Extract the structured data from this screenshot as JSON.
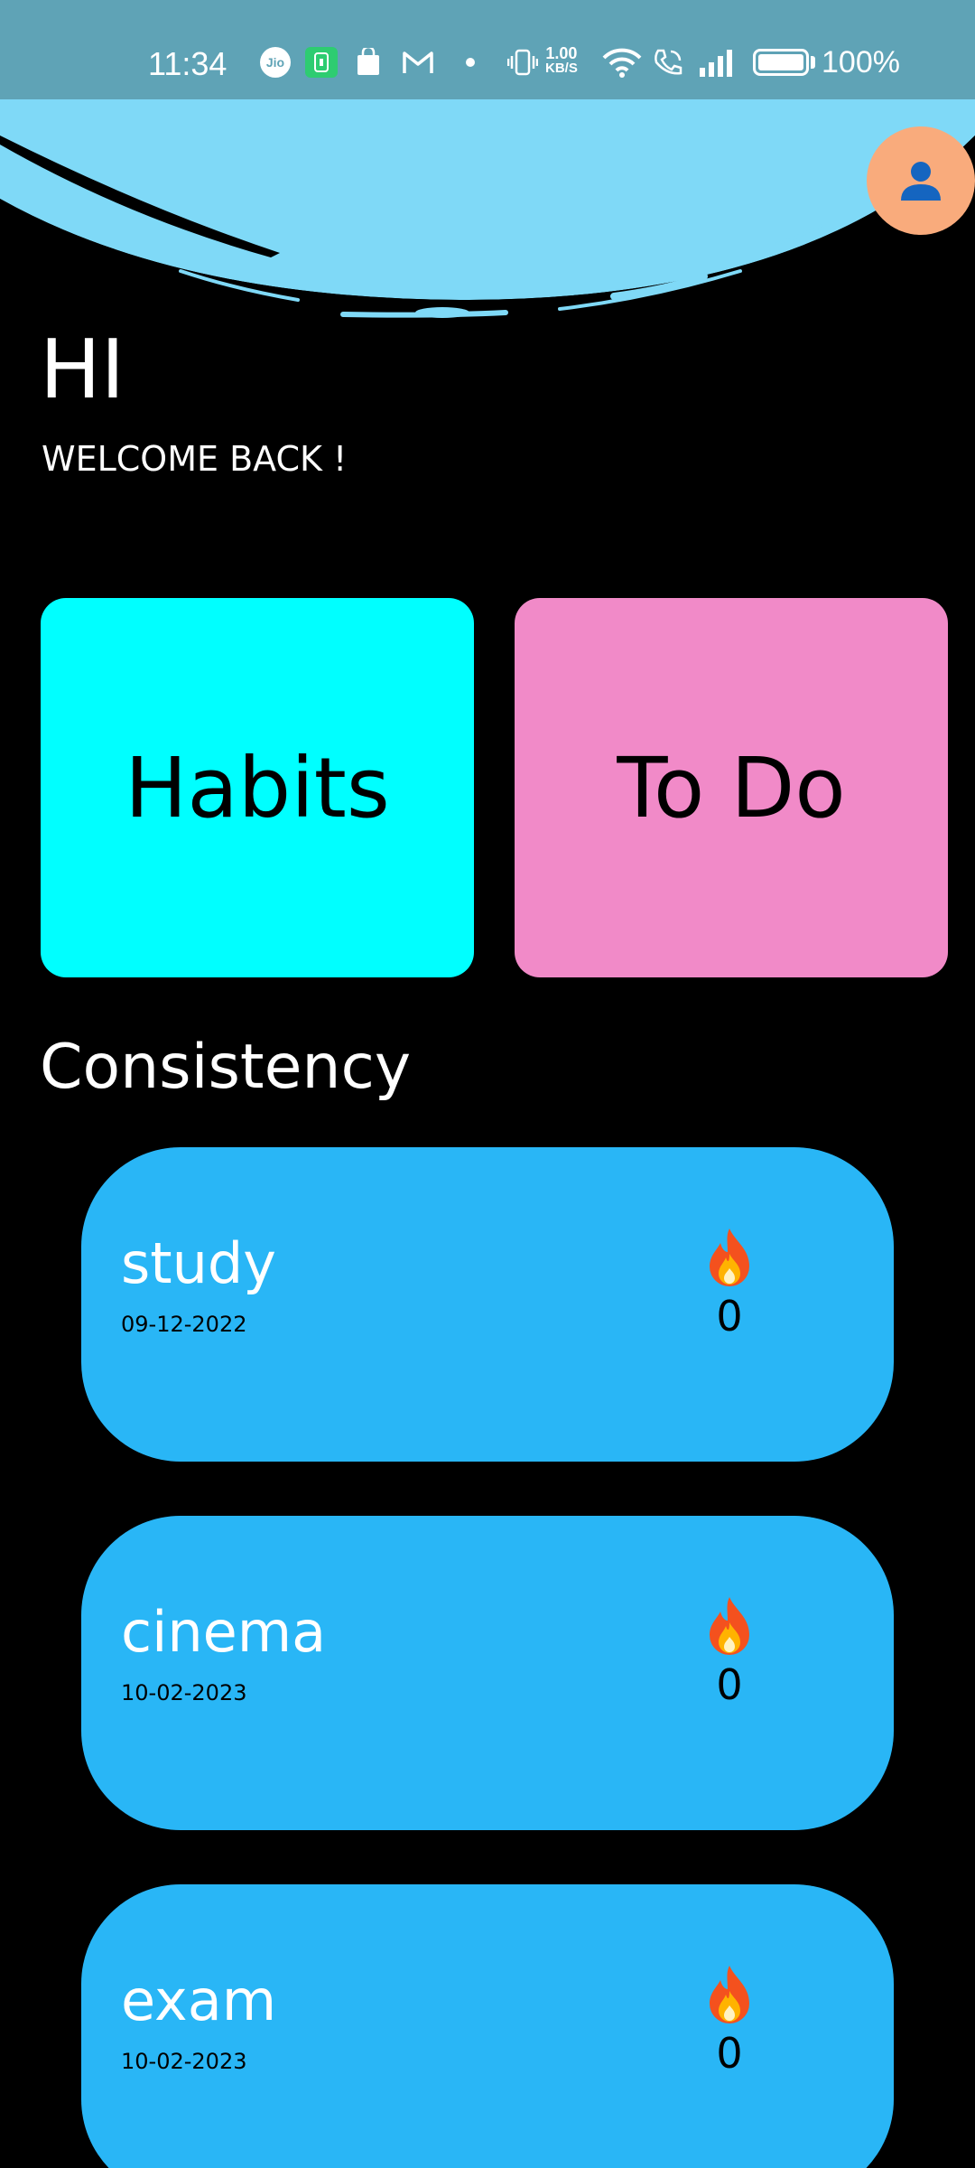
{
  "status_bar": {
    "time": "11:34",
    "carrier_icon_text": "Jio",
    "speed_value": "1.00",
    "speed_unit": "KB/S",
    "battery": "100%"
  },
  "greeting": {
    "title": "HI",
    "subtitle": "WELCOME BACK !"
  },
  "tiles": {
    "habits": "Habits",
    "todo": "To Do"
  },
  "consistency": {
    "title": "Consistency",
    "items": [
      {
        "name": "study",
        "date": "09-12-2022",
        "streak": "0"
      },
      {
        "name": "cinema",
        "date": "10-02-2023",
        "streak": "0"
      },
      {
        "name": "exam",
        "date": "10-02-2023",
        "streak": "0"
      }
    ]
  },
  "colors": {
    "status_bar": "#5fa3b6",
    "header_sky": "#7fd9f7",
    "profile": "#f9ab7c",
    "habits_tile": "#00ffff",
    "todo_tile": "#f18ac8",
    "habit_card": "#29b6f6"
  },
  "icons": {
    "profile": "person-icon",
    "streak": "fire-icon"
  }
}
